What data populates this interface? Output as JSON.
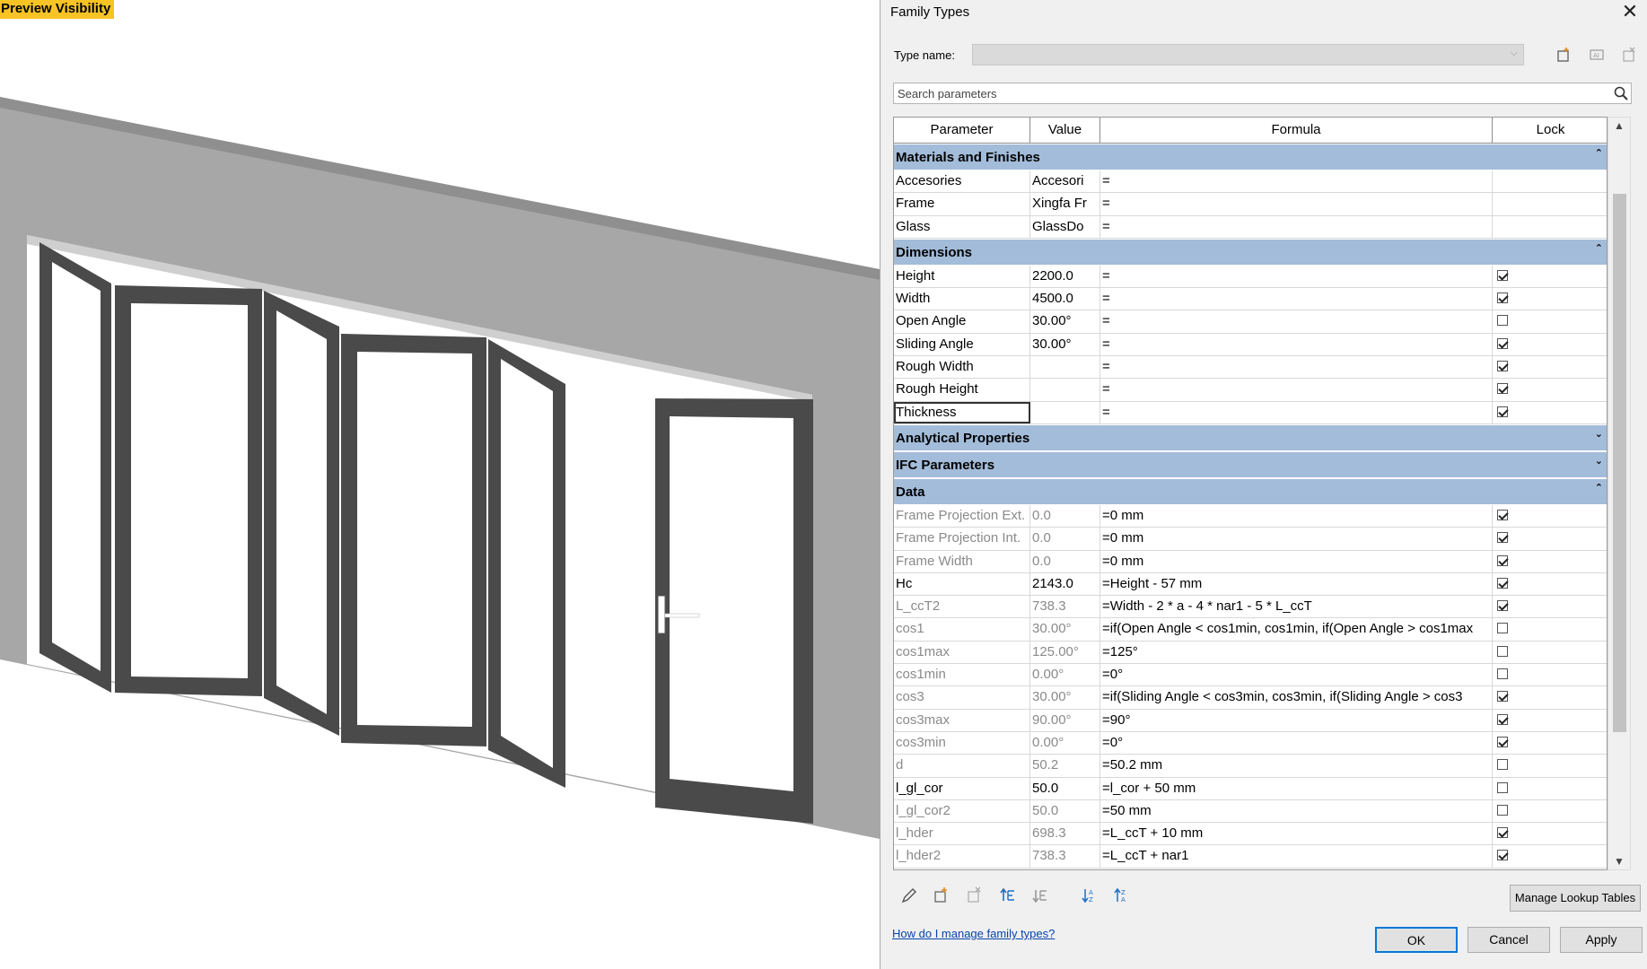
{
  "preview": {
    "badge": "Preview Visibility"
  },
  "dialog": {
    "title": "Family Types",
    "type_name_label": "Type name:",
    "type_name_value": "",
    "search_placeholder": "Search parameters",
    "columns": {
      "parameter": "Parameter",
      "value": "Value",
      "formula": "Formula",
      "lock": "Lock"
    },
    "groups": [
      {
        "name": "Materials and Finishes",
        "expanded": true,
        "rows": [
          {
            "param": "Accesories",
            "value": "Accesori",
            "formula": "=",
            "lock": null,
            "dim": false
          },
          {
            "param": "Frame",
            "value": "Xingfa Fr",
            "formula": "=",
            "lock": null,
            "dim": false
          },
          {
            "param": "Glass",
            "value": "GlassDo",
            "formula": "=",
            "lock": null,
            "dim": false
          }
        ]
      },
      {
        "name": "Dimensions",
        "expanded": true,
        "rows": [
          {
            "param": "Height",
            "value": "2200.0",
            "formula": "=",
            "lock": true,
            "dim": false
          },
          {
            "param": "Width",
            "value": "4500.0",
            "formula": "=",
            "lock": true,
            "dim": false
          },
          {
            "param": "Open Angle",
            "value": "30.00°",
            "formula": "=",
            "lock": false,
            "dim": false
          },
          {
            "param": "Sliding Angle",
            "value": "30.00°",
            "formula": "=",
            "lock": true,
            "dim": false
          },
          {
            "param": "Rough Width",
            "value": "",
            "formula": "=",
            "lock": true,
            "dim": false
          },
          {
            "param": "Rough Height",
            "value": "",
            "formula": "=",
            "lock": true,
            "dim": false
          },
          {
            "param": "Thickness",
            "value": "",
            "formula": "=",
            "lock": true,
            "dim": false,
            "selected": true
          }
        ]
      },
      {
        "name": "Analytical Properties",
        "expanded": false,
        "rows": []
      },
      {
        "name": "IFC Parameters",
        "expanded": false,
        "rows": []
      },
      {
        "name": "Data",
        "expanded": true,
        "rows": [
          {
            "param": "Frame Projection Ext.",
            "value": "0.0",
            "formula": "=0 mm",
            "lock": true,
            "dim": true
          },
          {
            "param": "Frame Projection Int.",
            "value": "0.0",
            "formula": "=0 mm",
            "lock": true,
            "dim": true
          },
          {
            "param": "Frame Width",
            "value": "0.0",
            "formula": "=0 mm",
            "lock": true,
            "dim": true
          },
          {
            "param": "Hc",
            "value": "2143.0",
            "formula": "=Height - 57 mm",
            "lock": true,
            "dim": false
          },
          {
            "param": "L_ccT2",
            "value": "738.3",
            "formula": "=Width - 2 * a - 4 * nar1 - 5 * L_ccT",
            "lock": true,
            "dim": true
          },
          {
            "param": "cos1",
            "value": "30.00°",
            "formula": "=if(Open Angle < cos1min, cos1min, if(Open Angle > cos1max",
            "lock": false,
            "dim": true
          },
          {
            "param": "cos1max",
            "value": "125.00°",
            "formula": "=125°",
            "lock": false,
            "dim": true
          },
          {
            "param": "cos1min",
            "value": "0.00°",
            "formula": "=0°",
            "lock": false,
            "dim": true
          },
          {
            "param": "cos3",
            "value": "30.00°",
            "formula": "=if(Sliding Angle < cos3min, cos3min, if(Sliding Angle > cos3",
            "lock": true,
            "dim": true
          },
          {
            "param": "cos3max",
            "value": "90.00°",
            "formula": "=90°",
            "lock": true,
            "dim": true
          },
          {
            "param": "cos3min",
            "value": "0.00°",
            "formula": "=0°",
            "lock": true,
            "dim": true
          },
          {
            "param": "d",
            "value": "50.2",
            "formula": "=50.2 mm",
            "lock": false,
            "dim": true
          },
          {
            "param": "l_gl_cor",
            "value": "50.0",
            "formula": "=l_cor + 50 mm",
            "lock": false,
            "dim": false
          },
          {
            "param": "l_gl_cor2",
            "value": "50.0",
            "formula": "=50 mm",
            "lock": false,
            "dim": true
          },
          {
            "param": "l_hder",
            "value": "698.3",
            "formula": "=L_ccT + 10 mm",
            "lock": true,
            "dim": true
          },
          {
            "param": "l_hder2",
            "value": "738.3",
            "formula": "=L_ccT + nar1",
            "lock": true,
            "dim": true
          }
        ]
      }
    ],
    "manage_lookup_label": "Manage Lookup Tables",
    "help_link": "How do I manage family types?",
    "ok_label": "OK",
    "cancel_label": "Cancel",
    "apply_label": "Apply"
  }
}
